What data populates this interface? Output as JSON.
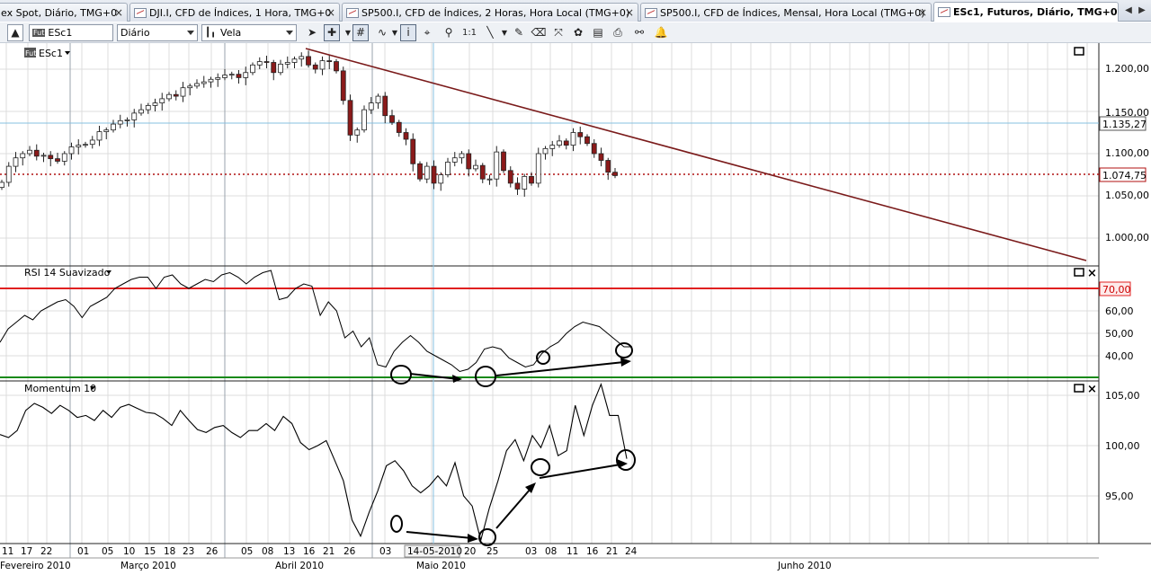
{
  "tabs": [
    {
      "label": "ex Spot, Diário, TMG+0",
      "active": false
    },
    {
      "label": "DJI.I, CFD de Índices, 1 Hora, TMG+0",
      "active": false
    },
    {
      "label": "SP500.I, CFD de Índices, 2 Horas, Hora Local (TMG+0)",
      "active": false
    },
    {
      "label": "SP500.I, CFD de Índices, Mensal, Hora Local (TMG+0)",
      "active": false
    },
    {
      "label": "ESc1, Futuros, Diário, TMG+0",
      "active": true
    }
  ],
  "toolbar": {
    "symbol": "ESc1",
    "symbol_badge": "Fut",
    "period": "Diário",
    "chart_style": "Vela",
    "zoom_label": "1:1"
  },
  "main_pane": {
    "legend": "ESc1",
    "legend_badge": "Fut",
    "price_axis": [
      "1.200,00",
      "1.150,00",
      "1.100,00",
      "1.050,00",
      "1.000,00"
    ],
    "crosshair_price": "1.135,27",
    "last_price": "1.074,75"
  },
  "rsi_pane": {
    "legend": "RSI 14 Suavizado",
    "axis": [
      "60,00",
      "50,00",
      "40,00"
    ],
    "level_label": "70,00"
  },
  "momentum_pane": {
    "legend": "Momentum 10",
    "axis": [
      "105,00",
      "100,00",
      "95,00"
    ]
  },
  "time_axis": {
    "days": [
      "11",
      "17",
      "22",
      "01",
      "05",
      "10",
      "15",
      "18",
      "23",
      "26",
      "05",
      "08",
      "13",
      "16",
      "21",
      "26",
      "03",
      "14-05-2010",
      "20",
      "25",
      "03",
      "08",
      "11",
      "16",
      "21",
      "24"
    ],
    "months": [
      "Fevereiro 2010",
      "Março 2010",
      "Abril 2010",
      "Maio 2010",
      "Junho 2010"
    ]
  },
  "colors": {
    "trendline": "#7a1a1a",
    "bear_candle": "#8b1a1a",
    "rsi_upper": "#e02020",
    "rsi_lower": "#1a8a1a",
    "crosshair": "#87c0e0",
    "grid": "#dcdcdc"
  },
  "chart_data": [
    {
      "type": "candlestick",
      "title": "ESc1",
      "ylim": [
        960,
        1225
      ],
      "closes": [
        1066,
        1085,
        1095,
        1100,
        1104,
        1097,
        1098,
        1094,
        1091,
        1100,
        1108,
        1110,
        1111,
        1116,
        1126,
        1128,
        1135,
        1139,
        1140,
        1148,
        1152,
        1157,
        1160,
        1165,
        1170,
        1168,
        1178,
        1180,
        1183,
        1185,
        1188,
        1190,
        1193,
        1194,
        1190,
        1196,
        1205,
        1209,
        1208,
        1196,
        1206,
        1208,
        1212,
        1215,
        1205,
        1200,
        1210,
        1209,
        1198,
        1163,
        1122,
        1128,
        1152,
        1160,
        1168,
        1145,
        1137,
        1125,
        1117,
        1088,
        1070,
        1085,
        1065,
        1075,
        1090,
        1095,
        1100,
        1082,
        1086,
        1070,
        1070,
        1102,
        1080,
        1065,
        1058,
        1073,
        1065,
        1100,
        1106,
        1110,
        1115,
        1110,
        1125,
        1120,
        1112,
        1100,
        1092,
        1078,
        1074
      ],
      "last_price": 1074.75
    },
    {
      "type": "line",
      "title": "RSI 14 Suavizado",
      "levels": [
        70,
        30
      ],
      "values": [
        46,
        52,
        55,
        58,
        56,
        60,
        62,
        64,
        65,
        62,
        57,
        62,
        64,
        66,
        70,
        72,
        74,
        75,
        75,
        70,
        75,
        76,
        72,
        70,
        72,
        74,
        73,
        76,
        77,
        75,
        72,
        75,
        77,
        78,
        65,
        66,
        70,
        72,
        71,
        58,
        64,
        60,
        48,
        51,
        44,
        48,
        36,
        35,
        42,
        46,
        49,
        46,
        42,
        40,
        38,
        36,
        33,
        34,
        37,
        43,
        44,
        43,
        39,
        37,
        35,
        36,
        41,
        44,
        46,
        50,
        53,
        55,
        54,
        53,
        50,
        47,
        44,
        44
      ],
      "annotations": "divergence arrows"
    },
    {
      "type": "line",
      "title": "Momentum 10",
      "values": [
        101.1,
        100.8,
        101.5,
        103.5,
        104.2,
        103.8,
        103.2,
        104.0,
        103.5,
        102.8,
        103.0,
        102.5,
        103.5,
        102.8,
        103.8,
        104.1,
        103.7,
        103.3,
        103.2,
        102.7,
        102.0,
        103.5,
        102.5,
        101.6,
        101.3,
        101.8,
        102.0,
        101.3,
        100.8,
        101.5,
        101.5,
        102.2,
        101.5,
        102.9,
        102.2,
        100.3,
        99.6,
        100.0,
        100.5,
        98.5,
        96.5,
        92.6,
        91.0,
        93.4,
        95.5,
        98.0,
        98.5,
        97.5,
        96.0,
        95.3,
        96.0,
        97.0,
        96.0,
        98.3,
        95.0,
        94.0,
        90.6,
        93.8,
        96.5,
        99.5,
        100.6,
        98.5,
        101.0,
        99.8,
        102.0,
        99.0,
        99.5,
        104.0,
        101.0,
        104.0,
        106.1,
        103.0,
        103.0,
        98.7
      ],
      "annotations": "divergence arrows"
    }
  ]
}
